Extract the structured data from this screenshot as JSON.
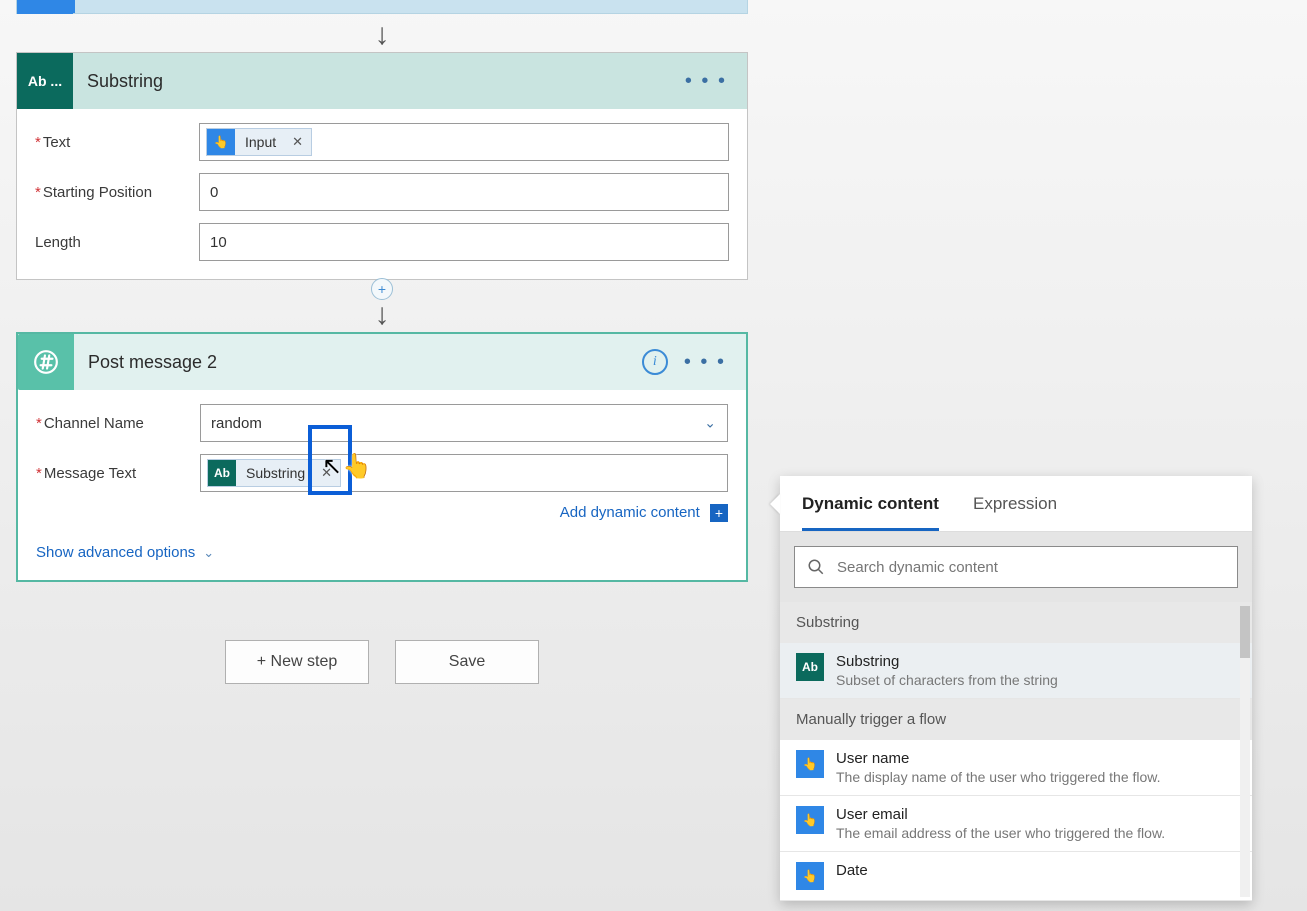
{
  "substring_card": {
    "icon_text": "Ab ...",
    "title": "Substring",
    "fields": {
      "text_label": "Text",
      "text_token": "Input",
      "start_label": "Starting Position",
      "start_value": "0",
      "length_label": "Length",
      "length_value": "10"
    }
  },
  "post_card": {
    "title": "Post message 2",
    "channel_label": "Channel Name",
    "channel_value": "random",
    "msg_label": "Message Text",
    "msg_token": "Substring",
    "add_dynamic": "Add dynamic content",
    "advanced": "Show advanced options"
  },
  "buttons": {
    "new_step": "+ New step",
    "save": "Save"
  },
  "dc": {
    "tab_dynamic": "Dynamic content",
    "tab_expression": "Expression",
    "search_placeholder": "Search dynamic content",
    "sections": [
      {
        "title": "Substring",
        "items": [
          {
            "icon": "teal",
            "icon_text": "Ab",
            "title": "Substring",
            "desc": "Subset of characters from the string",
            "selected": true
          }
        ]
      },
      {
        "title": "Manually trigger a flow",
        "items": [
          {
            "icon": "blue",
            "icon_text": "👆",
            "title": "User name",
            "desc": "The display name of the user who triggered the flow."
          },
          {
            "icon": "blue",
            "icon_text": "👆",
            "title": "User email",
            "desc": "The email address of the user who triggered the flow."
          },
          {
            "icon": "blue",
            "icon_text": "👆",
            "title": "Date",
            "desc": ""
          }
        ]
      }
    ]
  }
}
